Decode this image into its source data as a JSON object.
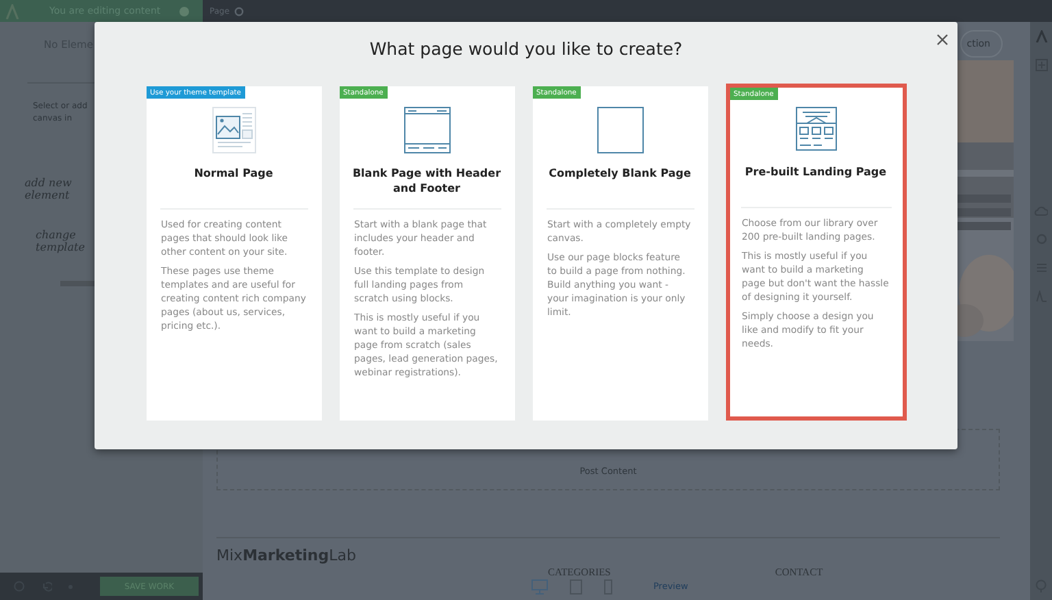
{
  "editor": {
    "top_bar": {
      "status": "You are editing content",
      "tab": "Page"
    },
    "sidebar": {
      "heading": "No Eleme",
      "hint_lines": [
        "Select or add",
        "canvas in"
      ],
      "notes": [
        "add new element",
        "change template"
      ]
    },
    "canvas": {
      "header_button": "ction",
      "section_label": "Post Content",
      "brand": "Mix**Marketing**Lab",
      "footer_headings": [
        "CATEGORIES",
        "CONTACT"
      ]
    },
    "bottom_bar": {
      "save_button": "SAVE WORK",
      "preview": "Preview"
    }
  },
  "dialog": {
    "title": "What page would you like to create?",
    "options": [
      {
        "badge": {
          "text": "Use your theme template",
          "color": "#1e9ad6"
        },
        "kind": "theme",
        "title": "Normal Page",
        "selected": false,
        "paragraphs": [
          "Used for creating content pages that should look like other content on your site.",
          "These pages use theme templates and are useful for creating content rich company pages (about us, services, pricing etc.)."
        ]
      },
      {
        "badge": {
          "text": "Standalone",
          "color": "#4caf50"
        },
        "kind": "header-footer",
        "title": "Blank Page with Header and Footer",
        "selected": false,
        "paragraphs": [
          "Start with a blank page that includes your header and footer.",
          "Use this template to design full landing pages from scratch using blocks.",
          "This is mostly useful if you want to build a marketing page from scratch (sales pages, lead generation pages, webinar registrations)."
        ]
      },
      {
        "badge": {
          "text": "Standalone",
          "color": "#4caf50"
        },
        "kind": "blank",
        "title": "Completely Blank Page",
        "selected": false,
        "paragraphs": [
          "Start with a completely empty canvas.",
          "Use our page blocks feature to build a page from nothing. Build anything you want - your imagination is your only limit."
        ]
      },
      {
        "badge": {
          "text": "Standalone",
          "color": "#4caf50"
        },
        "kind": "landing",
        "title": "Pre-built Landing Page",
        "selected": true,
        "paragraphs": [
          "Choose from our library over 200 pre-built landing pages.",
          "This is mostly useful if you want to build a marketing page but don't want the hassle of designing it yourself.",
          "Simply choose a design you like and modify to fit your needs."
        ]
      }
    ]
  }
}
